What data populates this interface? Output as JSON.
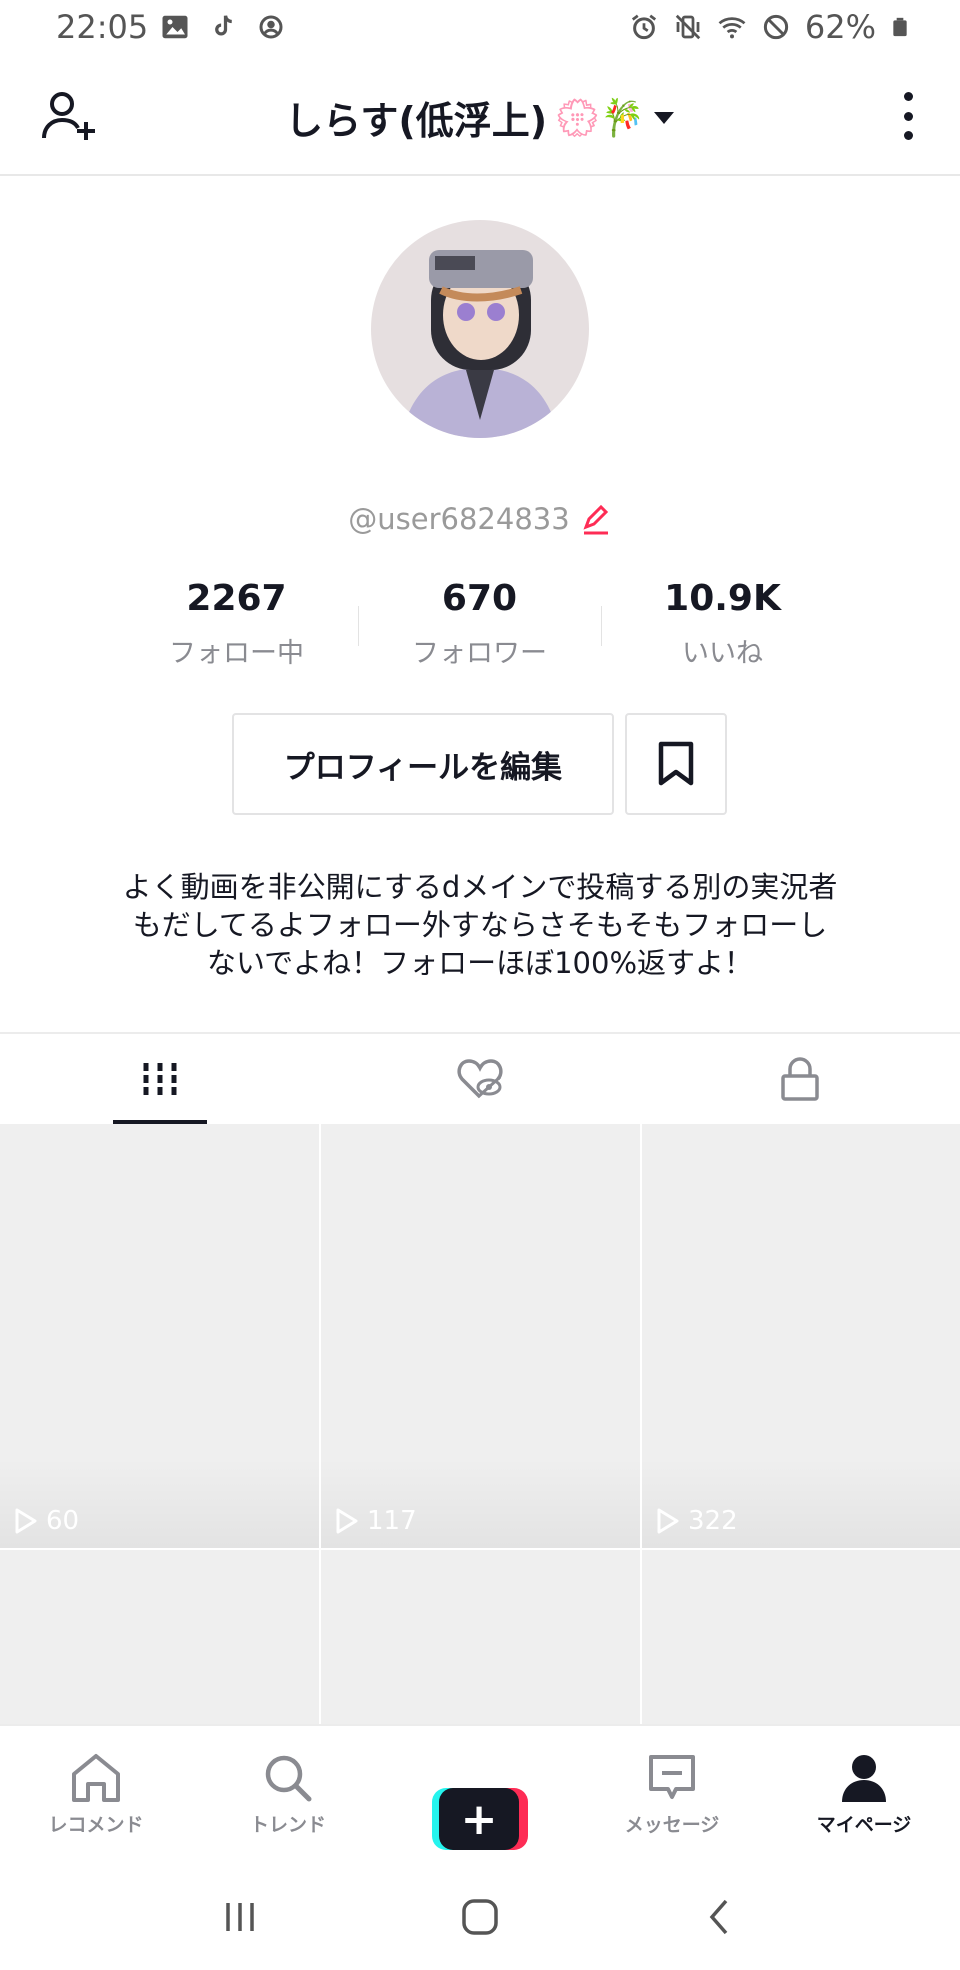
{
  "status_bar": {
    "time": "22:05",
    "battery_percent": "62%",
    "left_icons": [
      "gallery-icon",
      "tiktok-icon",
      "sync-icon"
    ],
    "right_icons": [
      "alarm-icon",
      "vibrate-icon",
      "wifi-icon",
      "do-not-disturb-icon",
      "battery-icon"
    ]
  },
  "header": {
    "title": "しらす(低浮上)",
    "title_emoji": "💮🎋",
    "add_user_icon": "add-user-icon",
    "more_icon": "more-vertical-icon"
  },
  "profile": {
    "handle": "@user6824833",
    "edit_icon_color": "#fe2c55",
    "stats": [
      {
        "value": "2267",
        "label": "フォロー中"
      },
      {
        "value": "670",
        "label": "フォロワー"
      },
      {
        "value": "10.9K",
        "label": "いいね"
      }
    ],
    "edit_button_label": "プロフィールを編集",
    "bio_lines": [
      "よく動画を非公開にするdメインで投稿する別の実況者",
      "もだしてるよフォロー外すならさそもそもフォローし",
      "ないでよね！フォローほぼ100%返すよ！"
    ]
  },
  "tabs": [
    {
      "icon": "videos-grid-icon",
      "active": true
    },
    {
      "icon": "liked-hidden-icon",
      "active": false
    },
    {
      "icon": "lock-icon",
      "active": false
    }
  ],
  "videos": [
    {
      "views": "60"
    },
    {
      "views": "117"
    },
    {
      "views": "322"
    },
    {
      "views": ""
    },
    {
      "views": ""
    },
    {
      "views": ""
    }
  ],
  "bottom_nav": {
    "items": [
      {
        "label": "レコメンド",
        "icon": "home-icon"
      },
      {
        "label": "トレンド",
        "icon": "search-icon"
      },
      {
        "label": "",
        "icon": "create-plus-icon"
      },
      {
        "label": "メッセージ",
        "icon": "message-icon"
      },
      {
        "label": "マイページ",
        "icon": "profile-icon"
      }
    ],
    "active_index": 4
  },
  "colors": {
    "text_primary": "#161823",
    "text_secondary": "#8a8b91",
    "accent_red": "#fe2c55",
    "accent_cyan": "#25f4ee",
    "grid_bg": "#efefef"
  }
}
